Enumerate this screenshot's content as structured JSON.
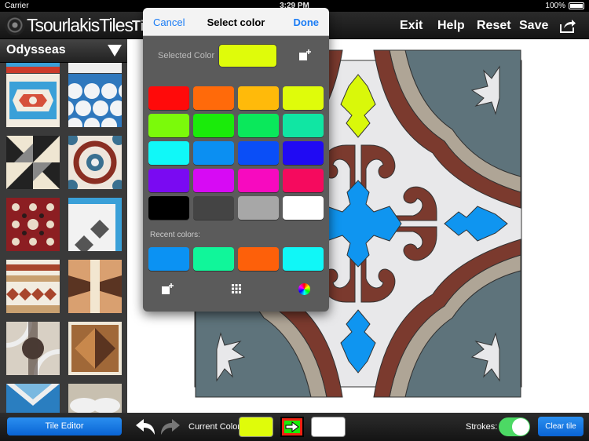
{
  "status": {
    "carrier": "Carrier",
    "time": "3:29 PM",
    "battery": "100%"
  },
  "topbar": {
    "brand": "TsourlakisTiles",
    "brand_partial": "Ti",
    "exit": "Exit",
    "help": "Help",
    "reset": "Reset",
    "save": "Save"
  },
  "sidebar": {
    "collection": "Odysseas"
  },
  "bottombar": {
    "tile_editor": "Tile Editor",
    "current_color_label": "Current Color:",
    "strokes_label": "Strokes:",
    "clear_tile": "Clear tile",
    "strokes_on": true
  },
  "colors": {
    "current": "#DFFC0A",
    "secondary": "#FFFFFF",
    "tile_gray": "#5E737B",
    "tile_brown": "#7B3A2E",
    "tile_beige": "#AFA596",
    "tile_blue": "#0F95F0",
    "tile_light": "#E8E8EA",
    "tile_yellow": "#D9F80A"
  },
  "picker": {
    "cancel": "Cancel",
    "title": "Select color",
    "done": "Done",
    "selected_label": "Selected Color",
    "selected_color": "#DFFC0A",
    "recent_label": "Recent colors:",
    "palette": [
      [
        "#FF0A0A",
        "#FF6A0A",
        "#FFBA0A",
        "#DFFC0A"
      ],
      [
        "#7BFA0A",
        "#1AEB0A",
        "#0AE85B",
        "#10E6A3"
      ],
      [
        "#10F8F8",
        "#0B8FF2",
        "#0A4EF7",
        "#200AF3"
      ],
      [
        "#7A0AF2",
        "#D70AF4",
        "#F70ABF",
        "#F50A5E"
      ],
      [
        "#000000",
        "#444444",
        "#A7A7A7",
        "#FFFFFF"
      ]
    ],
    "recent": [
      "#0B92F3",
      "#10F69A",
      "#FD600A",
      "#10F7F7"
    ]
  }
}
